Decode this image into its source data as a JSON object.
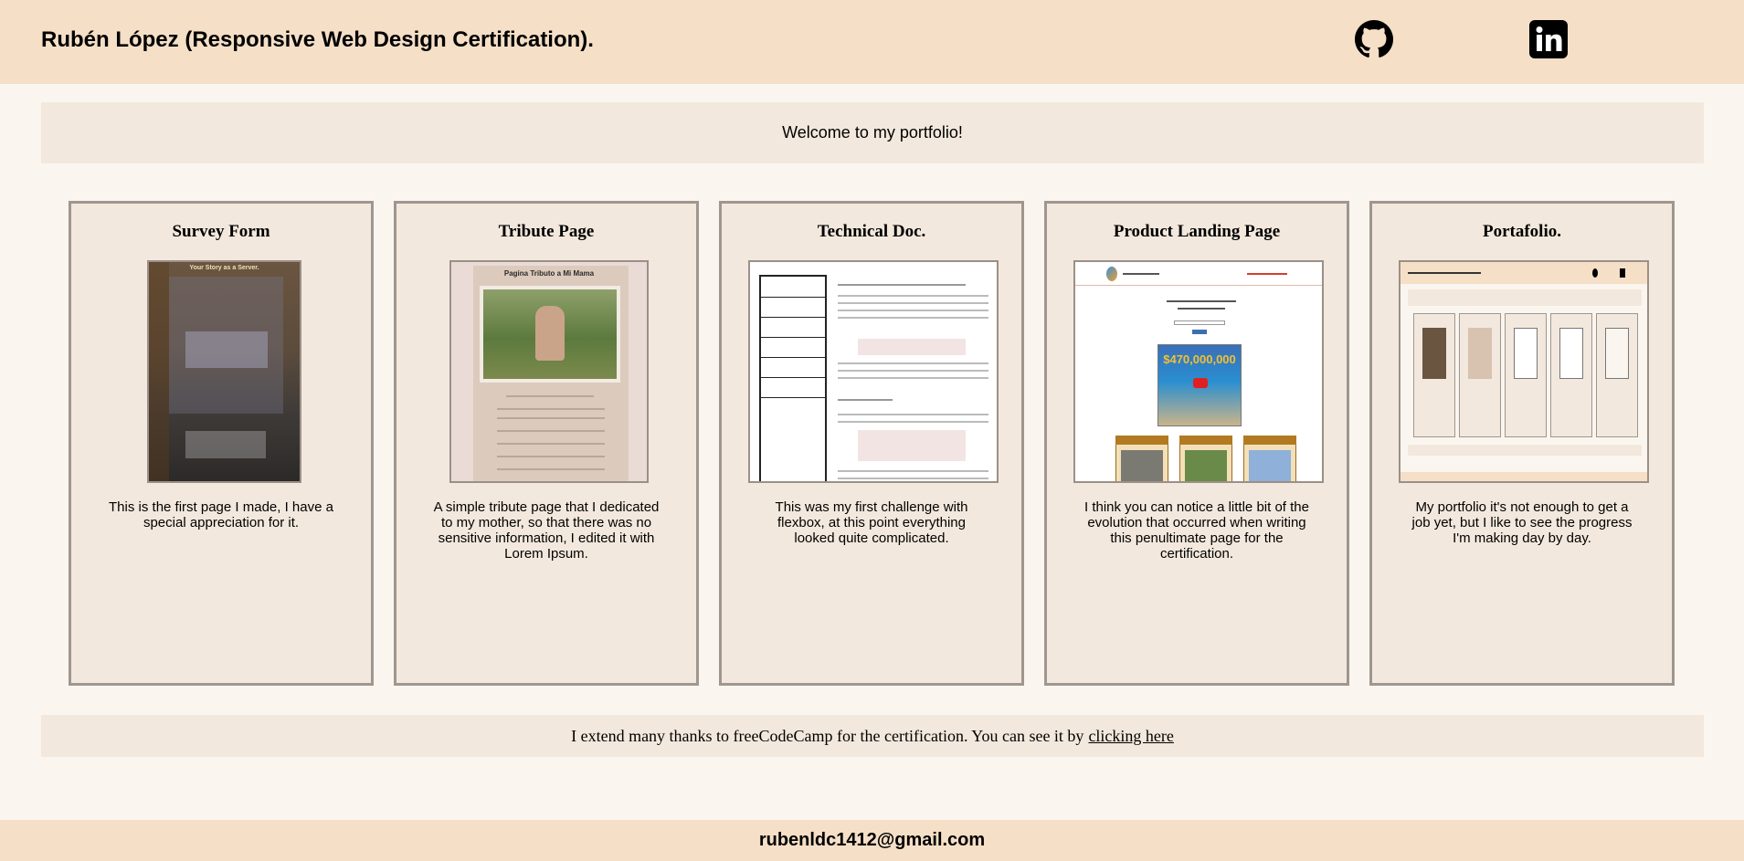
{
  "header": {
    "title": "Rubén López (Responsive Web Design Certification).",
    "github_icon": "github-icon",
    "linkedin_icon": "linkedin-icon"
  },
  "welcome": {
    "text": "Welcome to my portfolio!"
  },
  "projects": [
    {
      "title": "Survey Form",
      "description": "This is the first page I made, I have a special appreciation for it.",
      "thumb_heading": "Your Story as a Server."
    },
    {
      "title": "Tribute Page",
      "description": "A simple tribute page that I dedicated to my mother, so that there was no sensitive information, I edited it with Lorem Ipsum.",
      "thumb_heading": "Pagina Tributo a Mi Mama"
    },
    {
      "title": "Technical Doc.",
      "description": "This was my first challenge with flexbox, at this point everything looked quite complicated."
    },
    {
      "title": "Product Landing Page",
      "description": "I think you can notice a little bit of the evolution that occurred when writing this penultimate page for the certification.",
      "thumb_price": "$470,000,000"
    },
    {
      "title": "Portafolio.",
      "description": "My portfolio it's not enough to get a job yet, but I like to see the progress I'm making day by day."
    }
  ],
  "thanks": {
    "text": "I extend many thanks to freeCodeCamp for the certification. You can see it by",
    "link_label": "clicking here"
  },
  "footer": {
    "email": "rubenldc1412@gmail.com"
  },
  "colors": {
    "bar": "#f5dfc7",
    "panel": "#f3e8dd",
    "page": "#faf6ef",
    "card_border": "#9f9690"
  }
}
